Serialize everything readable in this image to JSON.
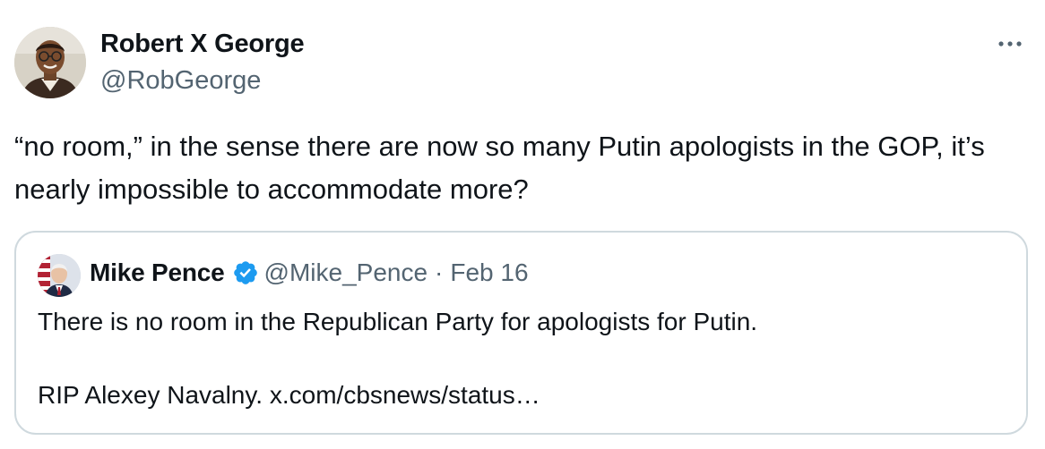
{
  "author": {
    "name": "Robert X George",
    "handle": "@RobGeorge"
  },
  "more_menu": {
    "icon": "more-horizontal-icon",
    "glyph": "···"
  },
  "tweet_text": "“no room,” in the sense there are now so many Putin apologists in the GOP, it’s nearly impossible to accommodate more?",
  "quoted_tweet": {
    "author_name": "Mike Pence",
    "verified": true,
    "verified_color": "#1d9bf0",
    "handle": "@Mike_Pence",
    "separator": "·",
    "date": "Feb 16",
    "text_line1": "There is no room in the Republican Party for apologists for Putin.",
    "text_line2_prefix": "RIP Alexey Navalny. ",
    "link": "x.com/cbsnews/status…"
  },
  "colors": {
    "primary_text": "#0f1419",
    "secondary_text": "#536471",
    "border": "#cfd9de"
  }
}
